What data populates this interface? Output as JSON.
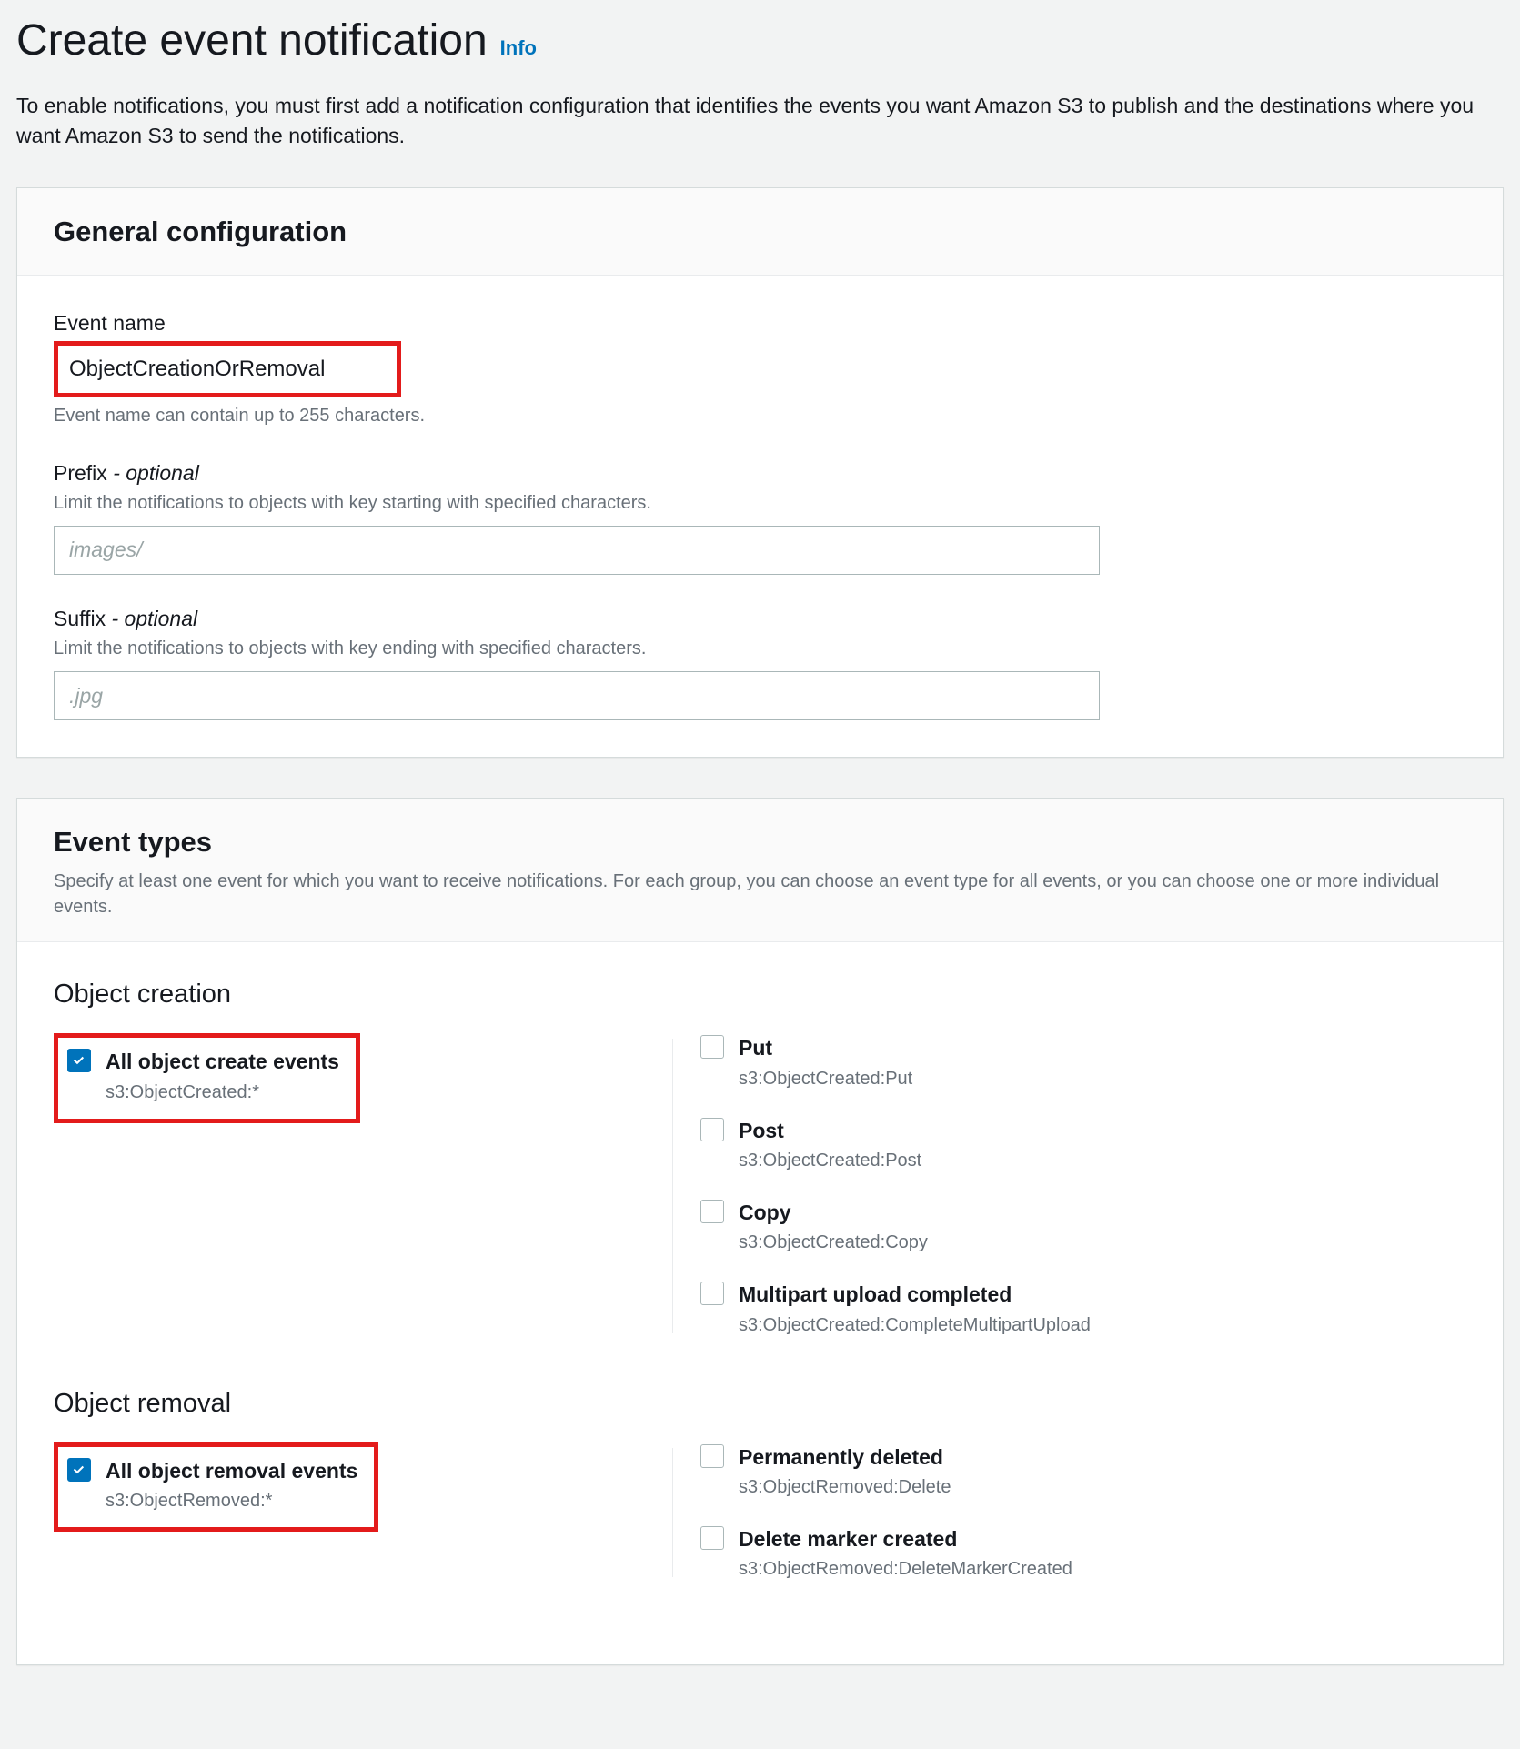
{
  "header": {
    "title": "Create event notification",
    "info_label": "Info",
    "description": "To enable notifications, you must first add a notification configuration that identifies the events you want Amazon S3 to publish and the destinations where you want Amazon S3 to send the notifications."
  },
  "general": {
    "panel_title": "General configuration",
    "event_name": {
      "label": "Event name",
      "value": "ObjectCreationOrRemoval",
      "hint_below": "Event name can contain up to 255 characters."
    },
    "prefix": {
      "label": "Prefix",
      "optional": "- optional",
      "hint": "Limit the notifications to objects with key starting with specified characters.",
      "placeholder": "images/"
    },
    "suffix": {
      "label": "Suffix",
      "optional": "- optional",
      "hint": "Limit the notifications to objects with key ending with specified characters.",
      "placeholder": ".jpg"
    }
  },
  "event_types": {
    "panel_title": "Event types",
    "panel_sub": "Specify at least one event for which you want to receive notifications. For each group, you can choose an event type for all events, or you can choose one or more individual events.",
    "sections": [
      {
        "title": "Object creation",
        "all": {
          "label": "All object create events",
          "sub": "s3:ObjectCreated:*",
          "checked": true
        },
        "items": [
          {
            "label": "Put",
            "sub": "s3:ObjectCreated:Put",
            "checked": false
          },
          {
            "label": "Post",
            "sub": "s3:ObjectCreated:Post",
            "checked": false
          },
          {
            "label": "Copy",
            "sub": "s3:ObjectCreated:Copy",
            "checked": false
          },
          {
            "label": "Multipart upload completed",
            "sub": "s3:ObjectCreated:CompleteMultipartUpload",
            "checked": false
          }
        ]
      },
      {
        "title": "Object removal",
        "all": {
          "label": "All object removal events",
          "sub": "s3:ObjectRemoved:*",
          "checked": true
        },
        "items": [
          {
            "label": "Permanently deleted",
            "sub": "s3:ObjectRemoved:Delete",
            "checked": false
          },
          {
            "label": "Delete marker created",
            "sub": "s3:ObjectRemoved:DeleteMarkerCreated",
            "checked": false
          }
        ]
      }
    ]
  }
}
